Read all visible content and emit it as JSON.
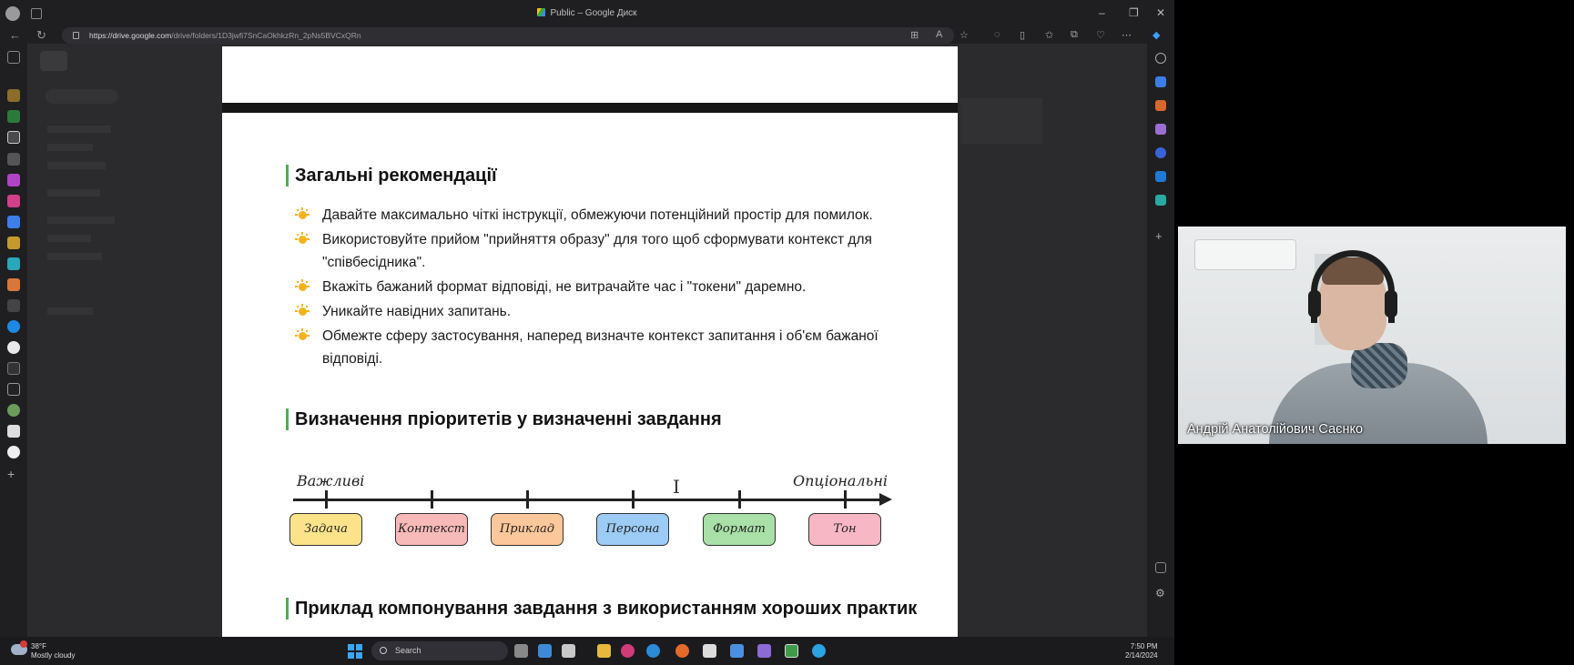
{
  "browser": {
    "window_title": "Public – Google Диск",
    "url_host": "https://drive.google.com",
    "url_path": "/drive/folders/1D3jwfi7SnCaOkhkzRn_2pNs5BVCxQRn"
  },
  "document": {
    "section1_title": "Загальні рекомендації",
    "bullets": [
      "Давайте максимально чіткі інструкції, обмежуючи потенційний простір для помилок.",
      "Використовуйте прийом \"прийняття образу\" для того щоб сформувати контекст для \"співбесідника\".",
      "Вкажіть бажаний формат відповіді, не витрачайте час і \"токени\" даремно.",
      "Уникайте навідних запитань.",
      "Обмежте сферу застосування, наперед визначте контекст запитання і об'єм бажаної відповіді."
    ],
    "section2_title": "Визначення пріоритетів у визначенні завдання",
    "timeline": {
      "left_label": "Важливі",
      "right_label": "Опціональні",
      "items": [
        {
          "label": "Задача",
          "color": "#fce38a"
        },
        {
          "label": "Контекст",
          "color": "#f8b9b9"
        },
        {
          "label": "Приклад",
          "color": "#fcc79a"
        },
        {
          "label": "Персона",
          "color": "#9ccbf5"
        },
        {
          "label": "Формат",
          "color": "#a8e0a8"
        },
        {
          "label": "Тон",
          "color": "#f8b7c4"
        }
      ]
    },
    "section3_title": "Приклад компонування завдання з використанням хороших практик"
  },
  "taskbar": {
    "temperature": "38°F",
    "weather": "Mostly cloudy",
    "weather_badge": "1",
    "search_label": "Search",
    "time": "7:50 PM",
    "date": "2/14/2024"
  },
  "webcam": {
    "participant_name": "Андрій Анатолійович Саєнко"
  }
}
